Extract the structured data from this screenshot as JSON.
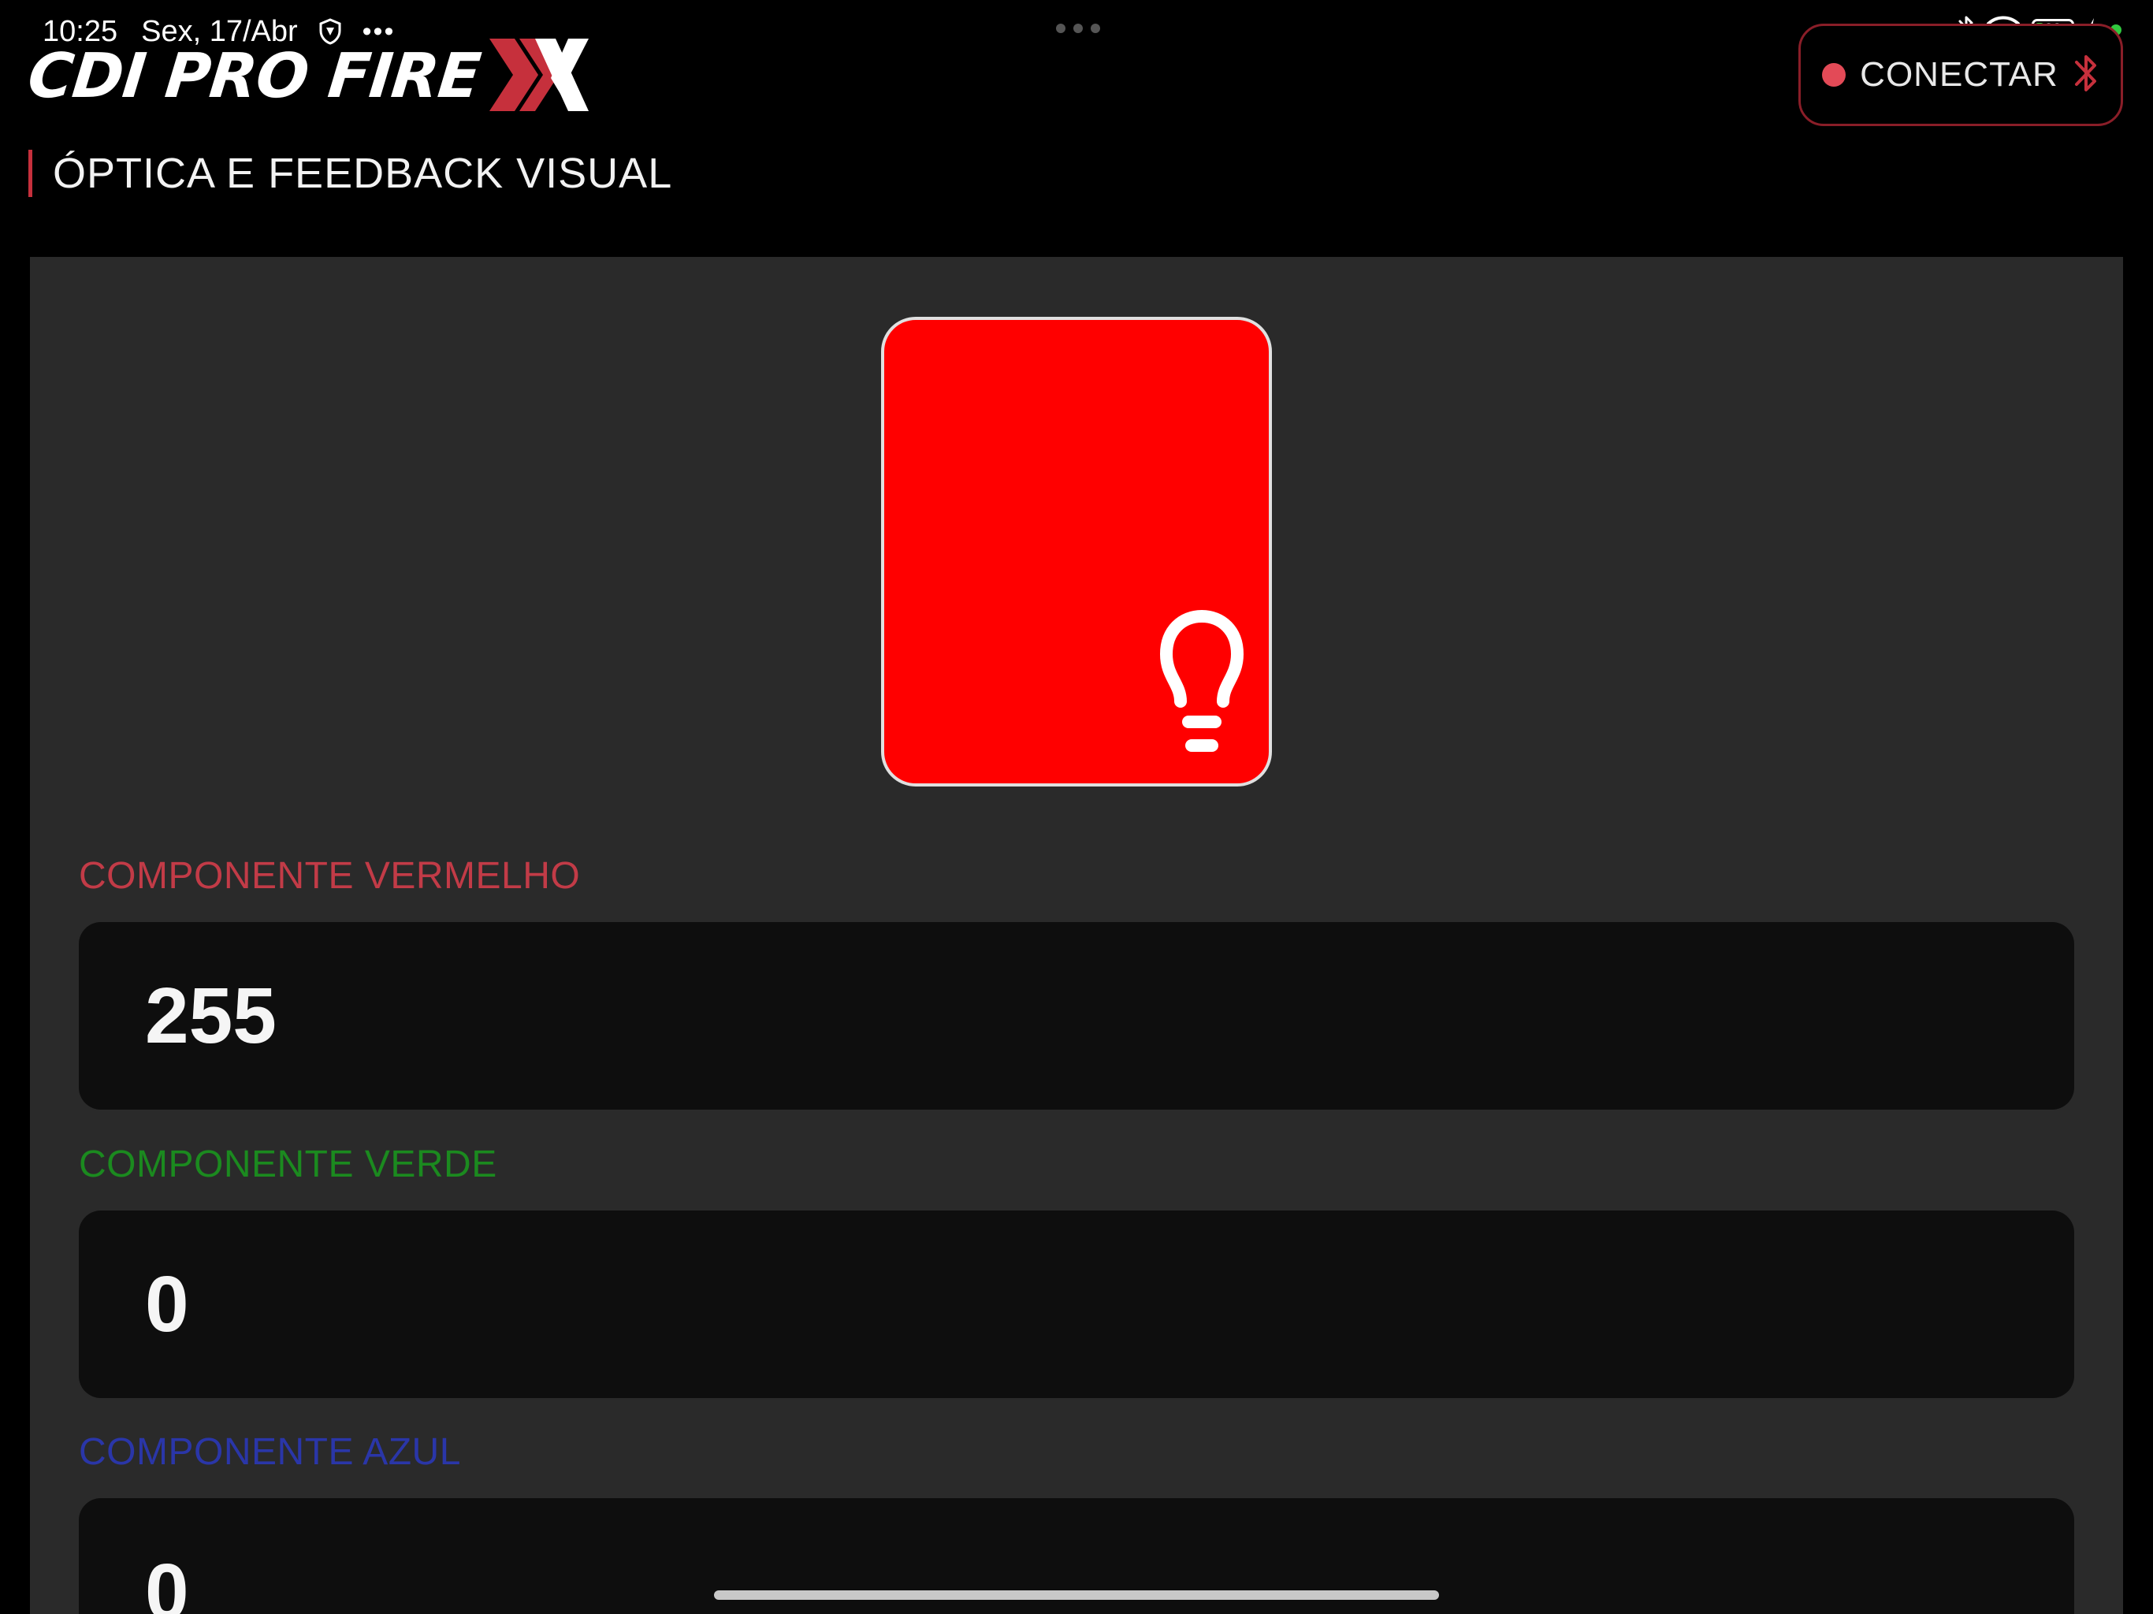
{
  "status_bar": {
    "time": "10:25",
    "date": "Sex, 17/Abr",
    "more": "•••",
    "battery_level": "22",
    "battery_fraction": 0.22
  },
  "header": {
    "logo_text": "CDI PRO FIRE",
    "connect_label": "CONECTAR"
  },
  "page": {
    "title": "ÓPTICA E FEEDBACK VISUAL"
  },
  "preview": {
    "color": "#ff0000",
    "icon": "lightbulb-icon"
  },
  "components": [
    {
      "label": "COMPONENTE VERMELHO",
      "value": "255",
      "color": "#c23b47"
    },
    {
      "label": "COMPONENTE VERDE",
      "value": "0",
      "color": "#1b8a1f"
    },
    {
      "label": "COMPONENTE AZUL",
      "value": "0",
      "color": "#2a36a8"
    }
  ],
  "colors": {
    "background": "#000000",
    "panel": "#2a2a2a",
    "field": "#0e0e0e",
    "accent": "#c6303c",
    "status_dot": "#e34a57",
    "battery_green": "#31c93f"
  }
}
